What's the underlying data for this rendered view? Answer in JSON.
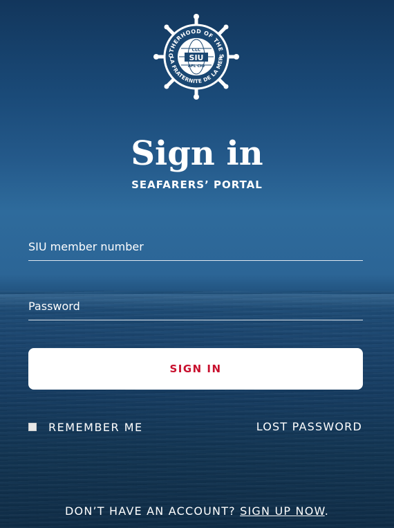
{
  "logo": {
    "ring_text_top": "BROTHERHOOD OF THE SEA",
    "ring_text_bottom": "LA FRATERNITE DE LA MER",
    "center_top": "CLC",
    "center_main": "SIU",
    "center_bottom": "AFL CIO"
  },
  "heading": {
    "title": "Sign in",
    "subtitle": "SEAFARERS’ PORTAL"
  },
  "form": {
    "member_number_placeholder": "SIU member number",
    "password_placeholder": "Password",
    "submit_label": "SIGN IN",
    "remember_label": "REMEMBER ME",
    "lost_password_label": "LOST PASSWORD"
  },
  "footer": {
    "prompt": "DON’T HAVE AN ACCOUNT? ",
    "signup_link": "SIGN UP NOW",
    "suffix": "."
  },
  "colors": {
    "accent_red": "#c8102e",
    "background_navy": "#12365c"
  }
}
